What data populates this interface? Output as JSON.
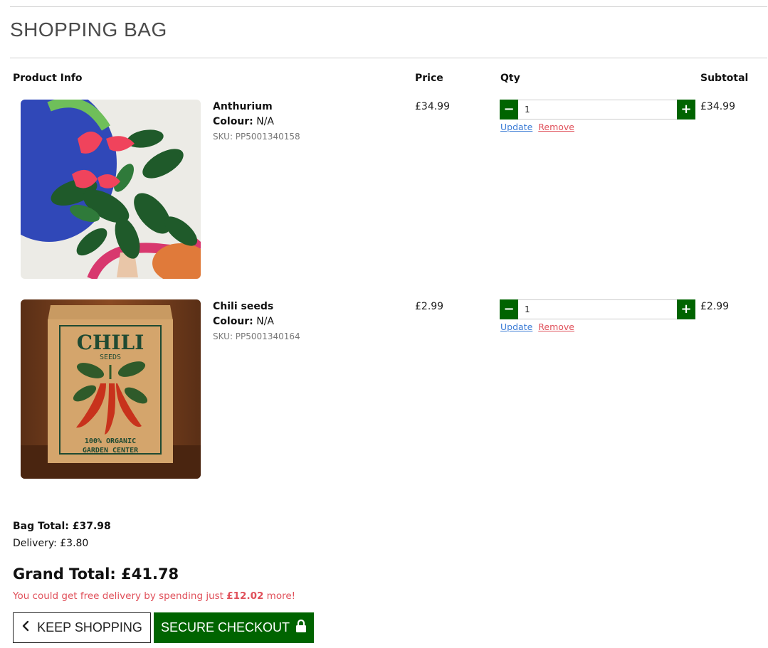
{
  "page": {
    "title": "SHOPPING BAG"
  },
  "table": {
    "headers": {
      "product": "Product Info",
      "price": "Price",
      "qty": "Qty",
      "subtotal": "Subtotal"
    }
  },
  "items": [
    {
      "name": "Anthurium",
      "colour_label": "Colour:",
      "colour": "N/A",
      "sku": "SKU: PP5001340158",
      "price": "£34.99",
      "qty": "1",
      "subtotal": "£34.99",
      "update_label": "Update",
      "remove_label": "Remove",
      "image_icon": "anthurium-plant-photo"
    },
    {
      "name": "Chili seeds",
      "colour_label": "Colour:",
      "colour": "N/A",
      "sku": "SKU: PP5001340164",
      "price": "£2.99",
      "qty": "1",
      "subtotal": "£2.99",
      "update_label": "Update",
      "remove_label": "Remove",
      "image_icon": "chili-seeds-packet-photo",
      "image_text": [
        "CHILI",
        "SEEDS",
        "100% ORGANIC",
        "GARDEN CENTER"
      ]
    }
  ],
  "qty_buttons": {
    "minus": "−",
    "plus": "+"
  },
  "summary": {
    "bag_total": "Bag Total: £37.98",
    "delivery": "Delivery: £3.80",
    "grand_total": "Grand Total: £41.78",
    "free_prefix": "You could get free delivery by spending just",
    "free_amount": "£12.02",
    "free_suffix": "more!"
  },
  "buttons": {
    "keep_shopping": "KEEP SHOPPING",
    "checkout": "SECURE CHECKOUT"
  },
  "colors": {
    "brand_green": "#006400",
    "remove_red": "#e0505a",
    "update_blue": "#3a7bd5"
  }
}
